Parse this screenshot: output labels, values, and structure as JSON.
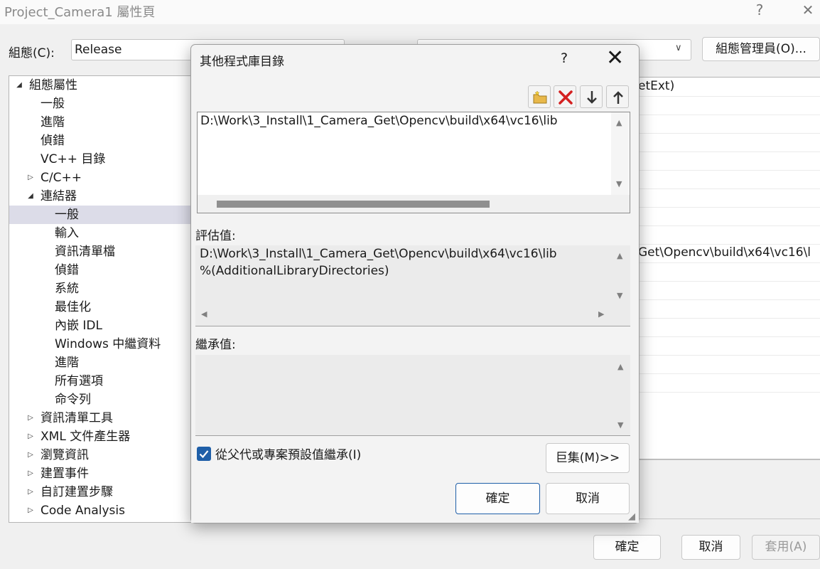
{
  "window": {
    "title": "Project_Camera1 屬性頁",
    "help": "?",
    "close": "✕"
  },
  "config_bar": {
    "config_label": "組態(C):",
    "config_value": "Release",
    "platform_value": "",
    "manager_button": "組態管理員(O)..."
  },
  "tree": {
    "items": [
      {
        "label": "組態屬性",
        "arrow": "◢",
        "level": 0
      },
      {
        "label": "一般",
        "level": 1
      },
      {
        "label": "進階",
        "level": 1
      },
      {
        "label": "偵錯",
        "level": 1
      },
      {
        "label": "VC++ 目錄",
        "level": 1
      },
      {
        "label": "C/C++",
        "arrow": "▷",
        "level": 1
      },
      {
        "label": "連結器",
        "arrow": "◢",
        "level": 1
      },
      {
        "label": "一般",
        "level": 2,
        "selected": true
      },
      {
        "label": "輸入",
        "level": 2
      },
      {
        "label": "資訊清單檔",
        "level": 2
      },
      {
        "label": "偵錯",
        "level": 2
      },
      {
        "label": "系統",
        "level": 2
      },
      {
        "label": "最佳化",
        "level": 2
      },
      {
        "label": "內嵌 IDL",
        "level": 2
      },
      {
        "label": "Windows 中繼資料",
        "level": 2
      },
      {
        "label": "進階",
        "level": 2
      },
      {
        "label": "所有選項",
        "level": 2
      },
      {
        "label": "命令列",
        "level": 2
      },
      {
        "label": "資訊清單工具",
        "arrow": "▷",
        "level": 1
      },
      {
        "label": "XML 文件產生器",
        "arrow": "▷",
        "level": 1
      },
      {
        "label": "瀏覽資訊",
        "arrow": "▷",
        "level": 1
      },
      {
        "label": "建置事件",
        "arrow": "▷",
        "level": 1
      },
      {
        "label": "自訂建置步驟",
        "arrow": "▷",
        "level": 1
      },
      {
        "label": "Code Analysis",
        "arrow": "▷",
        "level": 1
      }
    ]
  },
  "grid": {
    "visible_text_1": "etExt)",
    "visible_text_2": "Get\\Opencv\\build\\x64\\vc16\\l"
  },
  "footer": {
    "ok": "確定",
    "cancel": "取消",
    "apply": "套用(A)"
  },
  "dialog": {
    "title": "其他程式庫目錄",
    "help": "?",
    "close": "✕",
    "toolbar_icons": [
      "new-folder-icon",
      "delete-icon",
      "move-down-icon",
      "move-up-icon"
    ],
    "edit_value": "D:\\Work\\3_Install\\1_Camera_Get\\Opencv\\build\\x64\\vc16\\lib",
    "eval_label": "評估值:",
    "eval_lines": [
      "D:\\Work\\3_Install\\1_Camera_Get\\Opencv\\build\\x64\\vc16\\lib",
      "%(AdditionalLibraryDirectories)"
    ],
    "inherit_label": "繼承值:",
    "inherit_checkbox_label": "從父代或專案預設值繼承(I)",
    "inherit_checked": true,
    "macro_button": "巨集(M)>>",
    "ok_button": "確定",
    "cancel_button": "取消"
  },
  "colors": {
    "accent": "#1f5fa8",
    "selected_row": "#dcdce8",
    "delete_red": "#d42020"
  }
}
